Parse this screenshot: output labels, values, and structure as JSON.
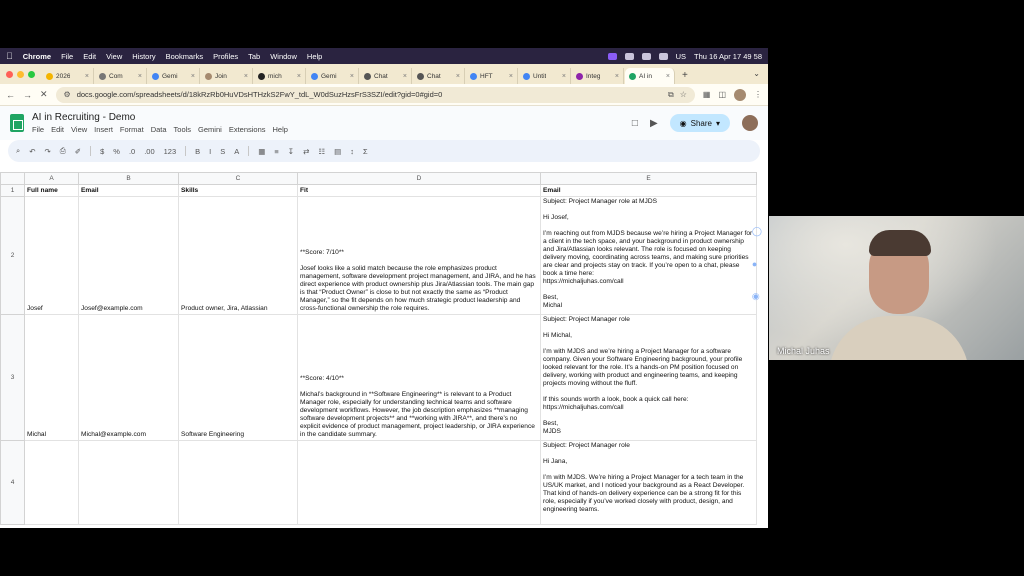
{
  "menubar": {
    "apple": "",
    "app": "Chrome",
    "items": [
      "File",
      "Edit",
      "View",
      "History",
      "Bookmarks",
      "Profiles",
      "Tab",
      "Window",
      "Help"
    ],
    "clock": "Thu 16 Apr  17 49 58",
    "lang": "US"
  },
  "tabs": [
    {
      "label": "2026",
      "color": "#f4b400"
    },
    {
      "label": "Com",
      "color": "#777777"
    },
    {
      "label": "Gemi",
      "color": "#4285f4"
    },
    {
      "label": "Join",
      "color": "#a58a6f"
    },
    {
      "label": "mich",
      "color": "#222222"
    },
    {
      "label": "Gemi",
      "color": "#4285f4"
    },
    {
      "label": "Chat",
      "color": "#555555"
    },
    {
      "label": "Chat",
      "color": "#555555"
    },
    {
      "label": "HFT",
      "color": "#4285f4"
    },
    {
      "label": "Untit",
      "color": "#4285f4"
    },
    {
      "label": "Integ",
      "color": "#8e24aa"
    },
    {
      "label": "AI in",
      "color": "#1fa463",
      "active": true
    }
  ],
  "address": {
    "url": "docs.google.com/spreadsheets/d/18kRzRb0HuVDsHTHzkS2FwY_tdL_W0dSuzHzsFrS3SZI/edit?gid=0#gid=0"
  },
  "sheet": {
    "title": "AI in Recruiting - Demo",
    "menus": [
      "File",
      "Edit",
      "View",
      "Insert",
      "Format",
      "Data",
      "Tools",
      "Gemini",
      "Extensions",
      "Help"
    ],
    "share_label": "Share"
  },
  "toolbar": {
    "items": [
      "⌕",
      "↶",
      "↷",
      "⎙",
      "✐",
      "$",
      "%",
      ".0",
      ".00",
      "123",
      "B",
      "I",
      "S",
      "A",
      "▦",
      "≡",
      "↧",
      "⇄",
      "☷",
      "▤",
      "↕",
      "Σ"
    ]
  },
  "grid": {
    "columns": [
      "A",
      "B",
      "C",
      "D",
      "E"
    ],
    "header": [
      "Full name",
      "Email",
      "Skills",
      "Fit",
      "Email"
    ],
    "rows": [
      {
        "num": "2",
        "name": "Josef",
        "email": "Josef@example.com",
        "skills": "Product owner, Jira, Atlassian",
        "fit": "**Score: 7/10**\n\nJosef looks like a solid match because the role emphasizes product management, software development project management, and JIRA, and he has direct experience with product ownership plus Jira/Atlassian tools. The main gap is that “Product Owner” is close to but not exactly the same as “Product Manager,” so the fit depends on how much strategic product leadership and cross-functional ownership the role requires.",
        "message": "Subject: Project Manager role at MJDS\n\nHi Josef,\n\nI’m reaching out from MJDS because we’re hiring a Project Manager for a client in the tech space, and your background in product ownership and Jira/Atlassian looks relevant. The role is focused on keeping delivery moving, coordinating across teams, and making sure priorities are clear and projects stay on track. If you’re open to a chat, please book a time here:\nhttps://michaljuhas.com/call\n\nBest,\nMichal"
      },
      {
        "num": "3",
        "name": "Michal",
        "email": "Michal@example.com",
        "skills": "Software Engineering",
        "fit": "**Score: 4/10**\n\nMichal’s background in **Software Engineering** is relevant to a Product Manager role, especially for understanding technical teams and software development workflows. However, the job description emphasizes **managing software development projects** and **working with JIRA**, and there’s no explicit evidence of product management, project leadership, or JIRA experience in the candidate summary.",
        "message": "Subject: Project Manager role\n\nHi Michal,\n\nI’m with MJDS and we’re hiring a Project Manager for a software company. Given your Software Engineering background, your profile looked relevant for the role. It’s a hands-on PM position focused on delivery, working with product and engineering teams, and keeping projects moving without the fluff.\n\nIf this sounds worth a look, book a quick call here:\nhttps://michaljuhas.com/call\n\nBest,\nMJDS"
      },
      {
        "num": "4",
        "name": "",
        "email": "",
        "skills": "",
        "fit": "",
        "message": "Subject: Project Manager role\n\nHi Jana,\n\nI’m with MJDS. We’re hiring a Project Manager for a tech team in the US/UK market, and I noticed your background as a React Developer. That kind of hands-on delivery experience can be a strong fit for this role, especially if you’ve worked closely with product, design, and engineering teams."
      }
    ]
  },
  "webcam": {
    "participant": "Michal Juhas"
  }
}
